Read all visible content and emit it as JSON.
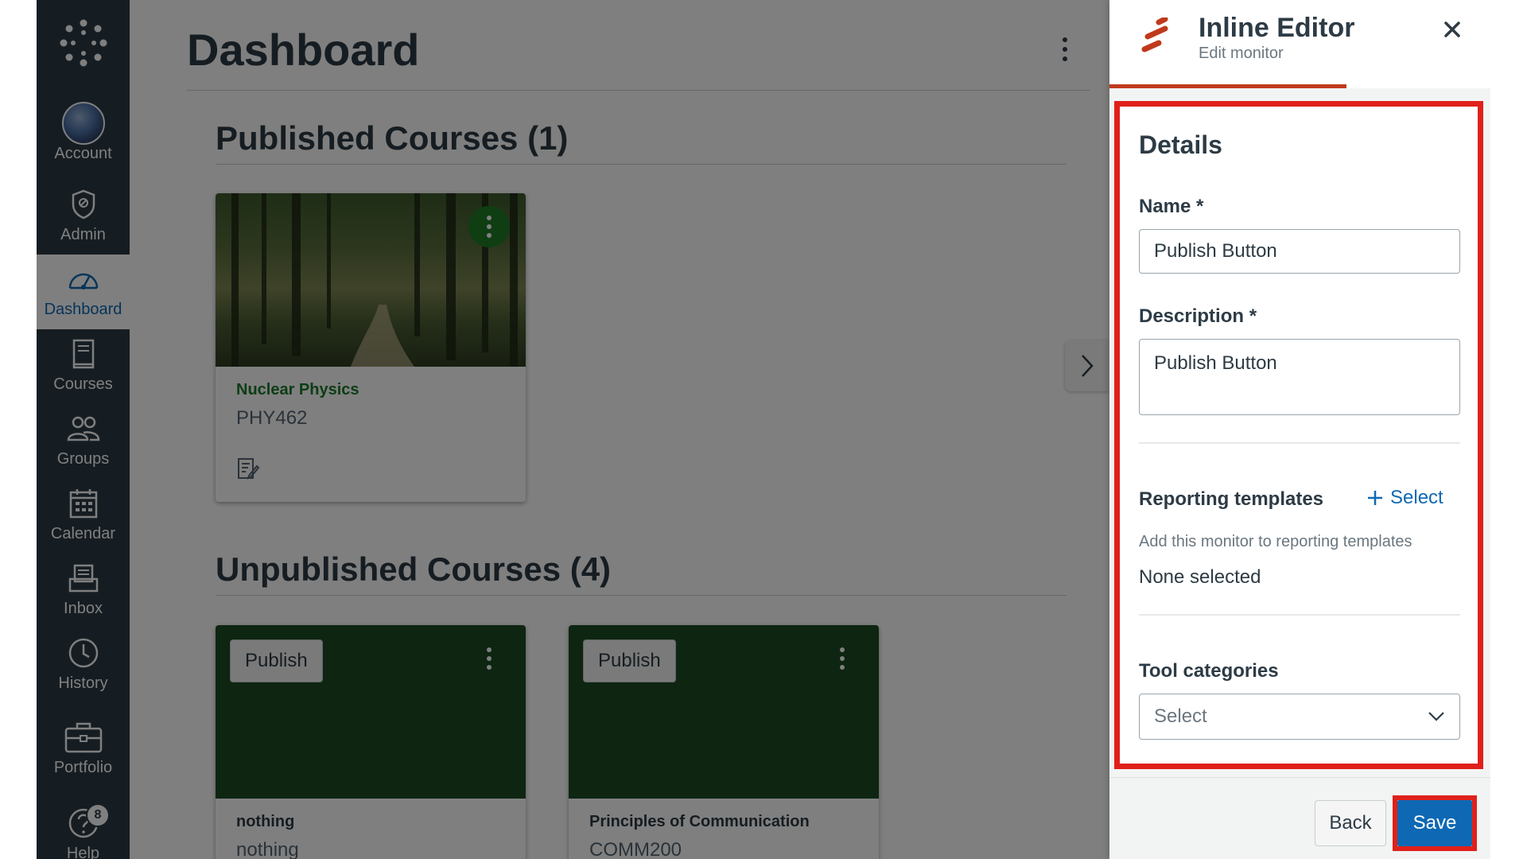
{
  "colors": {
    "nav_bg": "#2d3b45",
    "accent_blue": "#0e68b3",
    "brand_orange": "#c0391b",
    "highlight_red": "#e0201a",
    "course_green": "#1a7a2a"
  },
  "global_nav": {
    "logo_icon": "canvas-logo-icon",
    "items": [
      {
        "label": "Account",
        "icon": "avatar"
      },
      {
        "label": "Admin",
        "icon": "shield-icon"
      },
      {
        "label": "Dashboard",
        "icon": "dashboard-icon",
        "active": true
      },
      {
        "label": "Courses",
        "icon": "book-icon"
      },
      {
        "label": "Groups",
        "icon": "groups-icon"
      },
      {
        "label": "Calendar",
        "icon": "calendar-icon"
      },
      {
        "label": "Inbox",
        "icon": "inbox-icon"
      },
      {
        "label": "History",
        "icon": "clock-icon"
      },
      {
        "label": "Portfolio",
        "icon": "briefcase-icon"
      },
      {
        "label": "Help",
        "icon": "help-icon",
        "badge": "8"
      }
    ]
  },
  "dashboard": {
    "title": "Dashboard",
    "published_title": "Published Courses (1)",
    "unpublished_title": "Unpublished Courses (4)",
    "published_courses": [
      {
        "name": "Nuclear Physics",
        "code": "PHY462"
      }
    ],
    "unpublished_courses": [
      {
        "name": "nothing",
        "code": "nothing",
        "publish_label": "Publish"
      },
      {
        "name": "Principles of Communication",
        "code": "COMM200",
        "publish_label": "Publish"
      }
    ]
  },
  "panel": {
    "title": "Inline Editor",
    "subtitle": "Edit monitor",
    "details_title": "Details",
    "name_label": "Name *",
    "name_value": "Publish Button",
    "description_label": "Description *",
    "description_value": "Publish Button",
    "reporting_label": "Reporting templates",
    "select_link": "Select",
    "reporting_helper": "Add this monitor to reporting templates",
    "reporting_value": "None selected",
    "tool_categories_label": "Tool categories",
    "tool_categories_placeholder": "Select",
    "back_label": "Back",
    "save_label": "Save"
  }
}
